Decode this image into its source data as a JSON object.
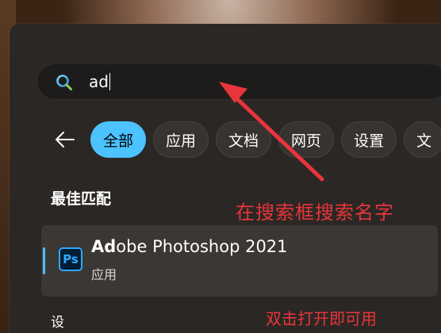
{
  "search": {
    "query": "ad"
  },
  "filters": {
    "chips": [
      {
        "label": "全部",
        "active": true
      },
      {
        "label": "应用",
        "active": false
      },
      {
        "label": "文档",
        "active": false
      },
      {
        "label": "网页",
        "active": false
      },
      {
        "label": "设置",
        "active": false
      },
      {
        "label": "文",
        "active": false
      }
    ]
  },
  "best_match": {
    "heading": "最佳匹配",
    "result": {
      "title_highlight": "Ad",
      "title_rest": "obe Photoshop 2021",
      "subtitle": "应用",
      "icon_text": "Ps"
    }
  },
  "annotations": {
    "search_hint": "在搜索框搜索名字",
    "bottom_hint": "双击打开即可用"
  },
  "bottom": {
    "heading": "设"
  },
  "colors": {
    "accent": "#4cc2ff",
    "annotation": "#e8353c",
    "photoshop_blue": "#31a8ff"
  }
}
